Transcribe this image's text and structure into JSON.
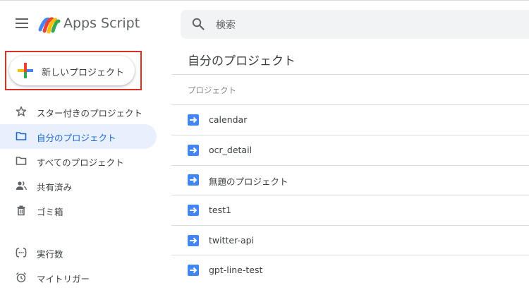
{
  "header": {
    "menu_icon": "hamburger-icon",
    "logo_icon": "apps-script-logo-icon",
    "title": "Apps Script",
    "search": {
      "icon": "search-icon",
      "placeholder": "検索"
    }
  },
  "new_project": {
    "label": "新しいプロジェクト",
    "icon": "colored-plus-icon",
    "highlight_color": "#d93025"
  },
  "sidebar": {
    "items": [
      {
        "label": "スター付きのプロジェクト",
        "icon": "star-icon"
      },
      {
        "label": "自分のプロジェクト",
        "icon": "folder-icon",
        "active": true
      },
      {
        "label": "すべてのプロジェクト",
        "icon": "folder-icon"
      },
      {
        "label": "共有済み",
        "icon": "people-icon"
      },
      {
        "label": "ゴミ箱",
        "icon": "trash-icon"
      },
      {
        "label": "実行数",
        "icon": "executions-icon"
      },
      {
        "label": "マイトリガー",
        "icon": "alarm-clock-icon"
      }
    ]
  },
  "main": {
    "title": "自分のプロジェクト",
    "column_header": "プロジェクト",
    "projects": [
      {
        "name": "calendar",
        "icon": "apps-script-file-icon"
      },
      {
        "name": "ocr_detail",
        "icon": "apps-script-file-icon"
      },
      {
        "name": "無題のプロジェクト",
        "icon": "apps-script-file-icon"
      },
      {
        "name": "test1",
        "icon": "apps-script-file-icon"
      },
      {
        "name": "twitter-api",
        "icon": "apps-script-file-icon"
      },
      {
        "name": "gpt-line-test",
        "icon": "apps-script-file-icon"
      }
    ]
  },
  "colors": {
    "accent": "#1967d2",
    "active_bg": "#e8f0fe",
    "file_icon": "#4285f4"
  }
}
